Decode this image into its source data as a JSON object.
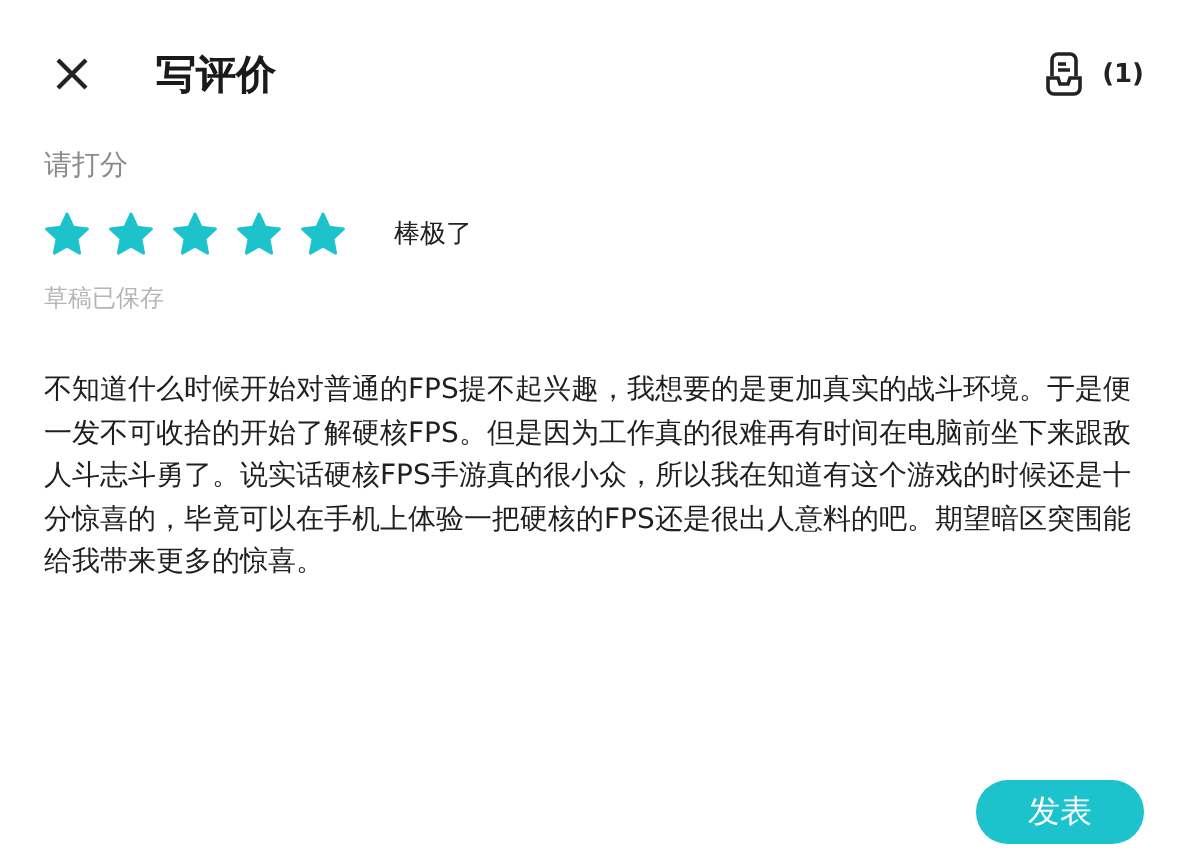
{
  "header": {
    "title": "写评价",
    "draft_count": "(1)"
  },
  "rating": {
    "prompt": "请打分",
    "stars": 5,
    "verdict": "棒极了",
    "draft_status": "草稿已保存"
  },
  "review": {
    "value": "不知道什么时候开始对普通的FPS提不起兴趣，我想要的是更加真实的战斗环境。于是便一发不可收拾的开始了解硬核FPS。但是因为工作真的很难再有时间在电脑前坐下来跟敌人斗志斗勇了。说实话硬核FPS手游真的很小众，所以我在知道有这个游戏的时候还是十分惊喜的，毕竟可以在手机上体验一把硬核的FPS还是很出人意料的吧。期望暗区突围能给我带来更多的惊喜。"
  },
  "submit_button": "发表"
}
